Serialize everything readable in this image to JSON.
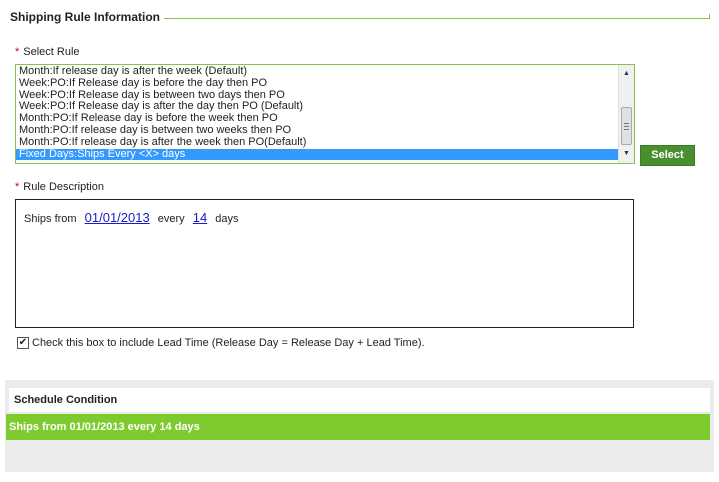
{
  "section": {
    "title": "Shipping Rule Information"
  },
  "select_rule": {
    "required_marker": "*",
    "label": "Select Rule",
    "items": [
      "Month:If release day is after the week (Default)",
      "Week:PO:If Release day is before the day then PO",
      "Week:PO:If Release day is between two days then PO",
      "Week:PO:If Release day is after the day then PO (Default)",
      "Month:PO:If Release day is before the week then PO",
      "Month:PO:If release day is between two weeks then PO",
      "Month:PO:If release day is after the week then PO(Default)",
      "Fixed Days:Ships Every <X> days"
    ],
    "selected_index": 7,
    "select_button": "Select"
  },
  "rule_description": {
    "required_marker": "*",
    "label": "Rule Description",
    "prefix": "Ships from",
    "date": "01/01/2013",
    "every": "every",
    "interval": "14",
    "unit": "days"
  },
  "lead_time": {
    "checked": true,
    "label": "Check this box to include Lead Time (Release Day = Release Day + Lead Time)."
  },
  "schedule_condition": {
    "title": "Schedule Condition",
    "summary": "Ships from 01/01/2013 every 14 days"
  },
  "colors": {
    "accent_green": "#7ecb2f",
    "button_green": "#4a8f2f",
    "selection_blue": "#3399ff",
    "link_blue": "#1a1acc",
    "required_red": "#d00000"
  }
}
